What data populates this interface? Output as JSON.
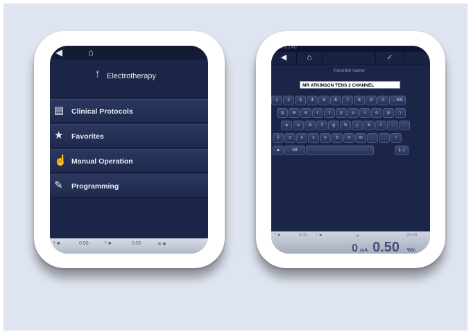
{
  "left_screen": {
    "nav": {
      "back_icon": "back-arrow-icon",
      "home_icon": "home-icon"
    },
    "title": "Electrotherapy",
    "title_icon": "electrode-icon",
    "menu": [
      {
        "label": "Clinical Protocols",
        "icon": "document-icon"
      },
      {
        "label": "Favorites",
        "icon": "star-icon"
      },
      {
        "label": "Manual Operation",
        "icon": "hand-icon"
      },
      {
        "label": "Programming",
        "icon": "edit-icon"
      }
    ],
    "bottom": {
      "time_a": "0:00",
      "time_b": "0:00"
    }
  },
  "right_screen": {
    "status_text": "SOPULS 492",
    "fav_label": "Favorite name",
    "input_value": "MR ATKINSON TENS 2 CHANNEL",
    "keyboard": {
      "row1": [
        "1",
        "2",
        "3",
        "4",
        "5",
        "6",
        "7",
        "8",
        "9",
        "0",
        "←BS"
      ],
      "row2": [
        "q",
        "w",
        "e",
        "r",
        "t",
        "y",
        "u",
        "i",
        "o",
        "p",
        "\\"
      ],
      "row3": [
        "a",
        "s",
        "d",
        "f",
        "g",
        "h",
        "j",
        "k",
        "l",
        ";",
        "'"
      ],
      "row4": [
        "⇧",
        "z",
        "x",
        "c",
        "v",
        "b",
        "n",
        "m",
        ",",
        ".",
        "/"
      ],
      "row5_left": "Alt",
      "row5_right": "[...]"
    },
    "bottom": {
      "time_a": "0:00",
      "time_b": "20:00",
      "current_value": "0",
      "current_unit": "mA",
      "power_value": "0.50",
      "power_unit": "W/c"
    }
  }
}
